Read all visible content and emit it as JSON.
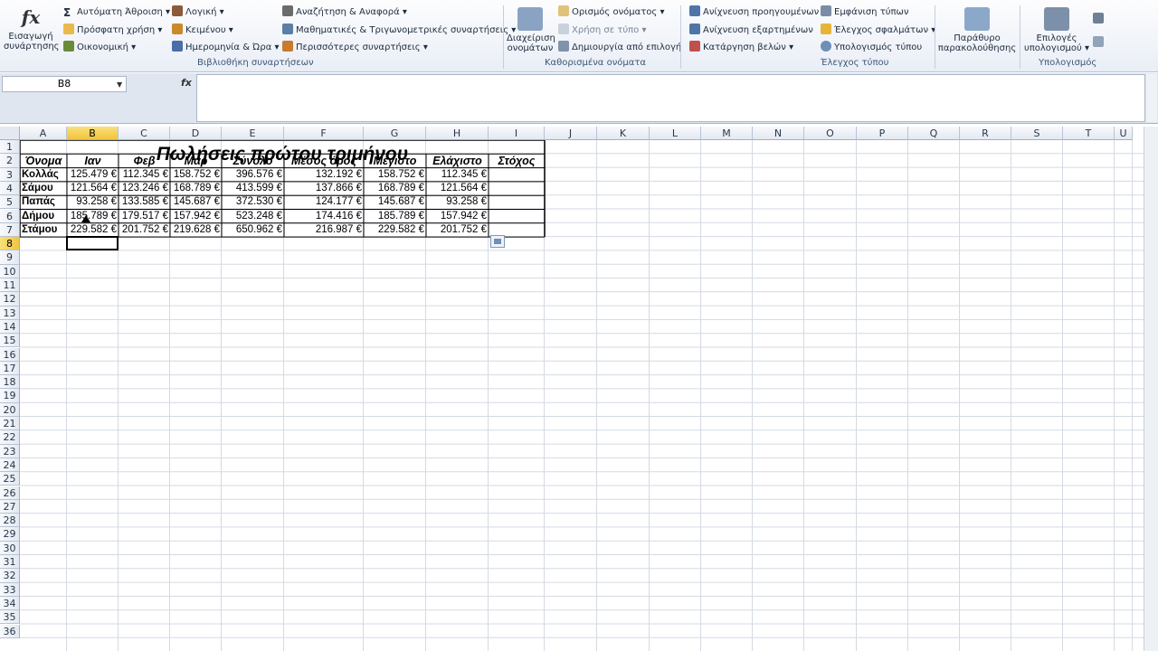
{
  "ribbon": {
    "insert_function": "Εισαγωγή συνάρτησης",
    "autosum": "Αυτόματη Άθροιση",
    "recent": "Πρόσφατη χρήση",
    "financial": "Οικονομική",
    "logical": "Λογική",
    "text": "Κειμένου",
    "datetime": "Ημερομηνία & Ώρα",
    "lookup": "Αναζήτηση & Αναφορά",
    "math": "Μαθηματικές & Τριγωνομετρικές συναρτήσεις",
    "more": "Περισσότερες συναρτήσεις",
    "group_library": "Βιβλιοθήκη συναρτήσεων",
    "name_manager": "Διαχείριση ονομάτων",
    "define_name": "Ορισμός ονόματος",
    "use_in_formula": "Χρήση σε τύπο",
    "create_from_selection": "Δημιουργία από επιλογή",
    "group_names": "Καθορισμένα ονόματα",
    "trace_precedents": "Ανίχνευση προηγουμένων",
    "trace_dependents": "Ανίχνευση εξαρτημένων",
    "remove_arrows": "Κατάργηση βελών",
    "show_formulas": "Εμφάνιση τύπων",
    "error_checking": "Έλεγχος σφαλμάτων",
    "evaluate_formula": "Υπολογισμός τύπου",
    "group_audit": "Έλεγχος τύπου",
    "watch_window": "Παράθυρο παρακολούθησης",
    "calc_options": "Επιλογές υπολογισμού",
    "group_calc": "Υπολογισμός"
  },
  "formula_bar": {
    "name_box": "B8",
    "fx": "fx",
    "formula": ""
  },
  "columns": [
    "A",
    "B",
    "C",
    "D",
    "E",
    "F",
    "G",
    "H",
    "I",
    "J",
    "K",
    "L",
    "M",
    "N",
    "O",
    "P",
    "Q",
    "R",
    "S",
    "T",
    "U"
  ],
  "selected_col": "B",
  "selected_row": 8,
  "sheet": {
    "title": "Πωλήσεις πρώτου τριμήνου",
    "headers": [
      "Όνομα",
      "Ιαν",
      "Φεβ",
      "Μαρ",
      "Σύνολο",
      "Μέσος όρος",
      "Μέγιστο",
      "Ελάχιστο",
      "Στόχος"
    ],
    "rows": [
      [
        "Κολλάς",
        "125.479 €",
        "112.345 €",
        "158.752 €",
        "396.576 €",
        "132.192 €",
        "158.752 €",
        "112.345 €",
        ""
      ],
      [
        "Σάμου",
        "121.564 €",
        "123.246 €",
        "168.789 €",
        "413.599 €",
        "137.866 €",
        "168.789 €",
        "121.564 €",
        ""
      ],
      [
        "Παπάς",
        "93.258 €",
        "133.585 €",
        "145.687 €",
        "372.530 €",
        "124.177 €",
        "145.687 €",
        "93.258 €",
        ""
      ],
      [
        "Δήμου",
        "185.789 €",
        "179.517 €",
        "157.942 €",
        "523.248 €",
        "174.416 €",
        "185.789 €",
        "157.942 €",
        ""
      ],
      [
        "Στάμου",
        "229.582 €",
        "201.752 €",
        "219.628 €",
        "650.962 €",
        "216.987 €",
        "229.582 €",
        "201.752 €",
        ""
      ]
    ]
  },
  "colors": {
    "selected_header": "#f1c43e",
    "grid": "#d4dae3",
    "ribbon_text": "#1e2c3e"
  }
}
